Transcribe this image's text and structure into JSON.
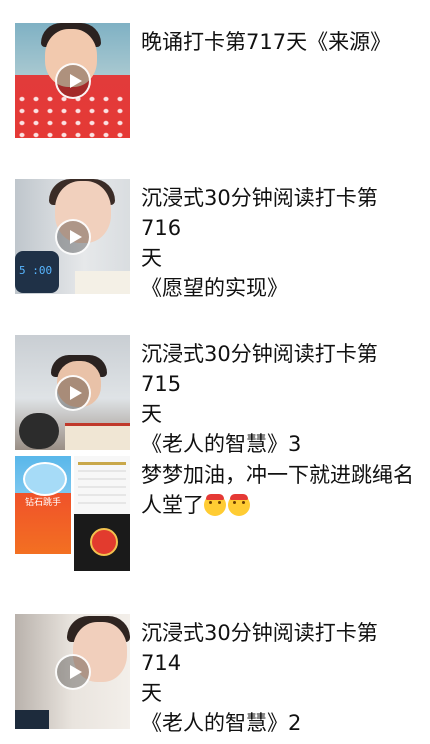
{
  "feed": {
    "posts": [
      {
        "lines": [
          "晚诵打卡第717天《来源》"
        ],
        "thumbnail": "video-thumbnail"
      },
      {
        "lines": [
          "沉浸式30分钟阅读打卡第716",
          "天",
          "《愿望的实现》"
        ],
        "thumbnail": "video-thumbnail"
      },
      {
        "lines": [
          "沉浸式30分钟阅读打卡第715",
          "天",
          "《老人的智慧》3"
        ],
        "thumbnail": "video-thumbnail"
      },
      {
        "lines": [
          "梦梦加油，冲一下就进跳绳名",
          "人堂了"
        ],
        "images": 2,
        "emoji_count": 2,
        "thumbnail_text": "钻石跳手"
      },
      {
        "lines": [
          "沉浸式30分钟阅读打卡第714",
          "天",
          "《老人的智慧》2"
        ],
        "thumbnail": "video-thumbnail"
      }
    ]
  },
  "icons": {
    "play": "play-icon",
    "emoji": "hug-face-emoji"
  }
}
